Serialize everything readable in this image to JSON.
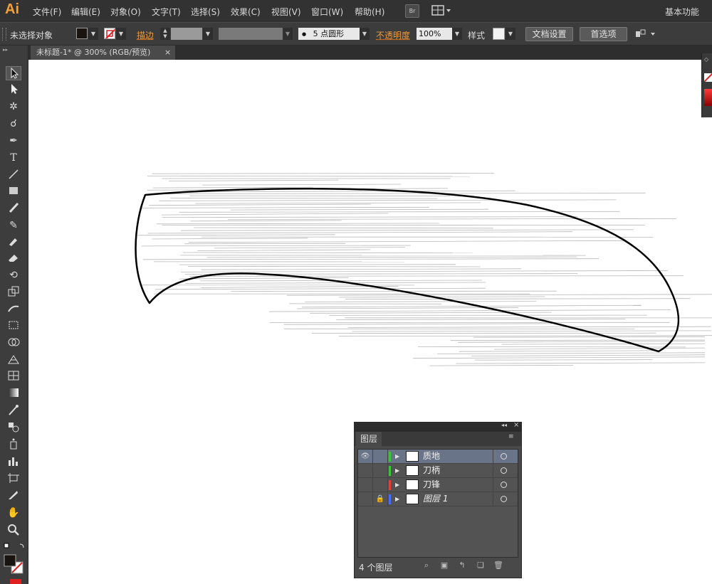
{
  "app": {
    "logo": "Ai",
    "workspace": "基本功能"
  },
  "menu": [
    "文件(F)",
    "编辑(E)",
    "对象(O)",
    "文字(T)",
    "选择(S)",
    "效果(C)",
    "视图(V)",
    "窗口(W)",
    "帮助(H)"
  ],
  "menu_extra": {
    "bridge_label": "Br",
    "arrange_icon": "arrange-documents-icon"
  },
  "control_bar": {
    "selection_status": "未选择对象",
    "fill_color": "#1a1410",
    "stroke_label": "描边",
    "brush_dot": "●",
    "brush_size": "5",
    "brush_shape": "点圆形",
    "opacity_label": "不透明度",
    "opacity_value": "100%",
    "style_label": "样式",
    "doc_setup_button": "文档设置",
    "preferences_button": "首选项"
  },
  "document_tab": {
    "title": "未标题-1* @ 300% (RGB/预览)",
    "close": "×"
  },
  "tools": [
    "selection-tool",
    "direct-selection-tool",
    "magic-wand-tool",
    "lasso-tool",
    "pen-tool",
    "type-tool",
    "line-segment-tool",
    "rectangle-tool",
    "paintbrush-tool",
    "pencil-tool",
    "blob-brush-tool",
    "eraser-tool",
    "rotate-tool",
    "scale-tool",
    "warp-tool",
    "free-transform-tool",
    "shape-builder-tool",
    "perspective-grid-tool",
    "mesh-tool",
    "gradient-tool",
    "eyedropper-tool",
    "blend-tool",
    "symbol-sprayer-tool",
    "column-graph-tool",
    "artboard-tool",
    "slice-tool",
    "hand-tool",
    "zoom-tool"
  ],
  "layers_panel": {
    "title": "图层",
    "count_label": "4 个图层",
    "layers": [
      {
        "name": "质地",
        "color": "#3cc43c",
        "selected": true,
        "visible": true,
        "locked": false,
        "italic": false
      },
      {
        "name": "刀柄",
        "color": "#3cc43c",
        "selected": false,
        "visible": false,
        "locked": false,
        "italic": false
      },
      {
        "name": "刀锋",
        "color": "#e04040",
        "selected": false,
        "visible": false,
        "locked": false,
        "italic": false
      },
      {
        "name": "图层 1",
        "color": "#4a6cff",
        "selected": false,
        "visible": false,
        "locked": true,
        "italic": true
      }
    ]
  },
  "colors": {
    "ui_dark": "#323232",
    "accent_orange": "#f09a3a",
    "artwork_stroke": "#000000",
    "hatch_lines": "#b8b8b8"
  }
}
